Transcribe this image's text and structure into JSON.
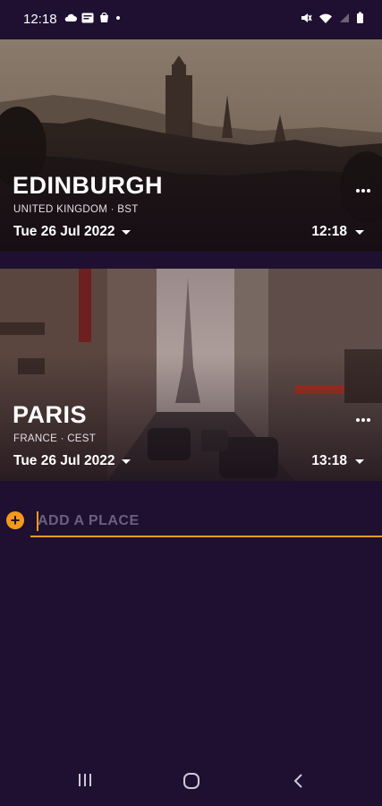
{
  "status_bar": {
    "time": "12:18",
    "left_icons": [
      "cloud-icon",
      "news-icon",
      "shopping-bag-icon",
      "dot-icon"
    ],
    "right_icons": [
      "mute-icon",
      "wifi-icon",
      "signal-icon",
      "battery-icon"
    ]
  },
  "places": [
    {
      "city": "EDINBURGH",
      "subtitle": "UNITED KINGDOM · BST",
      "date": "Tue 26 Jul 2022",
      "time": "12:18"
    },
    {
      "city": "PARIS",
      "subtitle": "FRANCE · CEST",
      "date": "Tue 26 Jul 2022",
      "time": "13:18"
    }
  ],
  "add_place": {
    "placeholder": "ADD A PLACE",
    "value": ""
  },
  "colors": {
    "background": "#1f1032",
    "accent": "#f39a1c"
  },
  "nav_bar": {
    "buttons": [
      "recent-apps-icon",
      "home-icon",
      "back-icon"
    ]
  }
}
